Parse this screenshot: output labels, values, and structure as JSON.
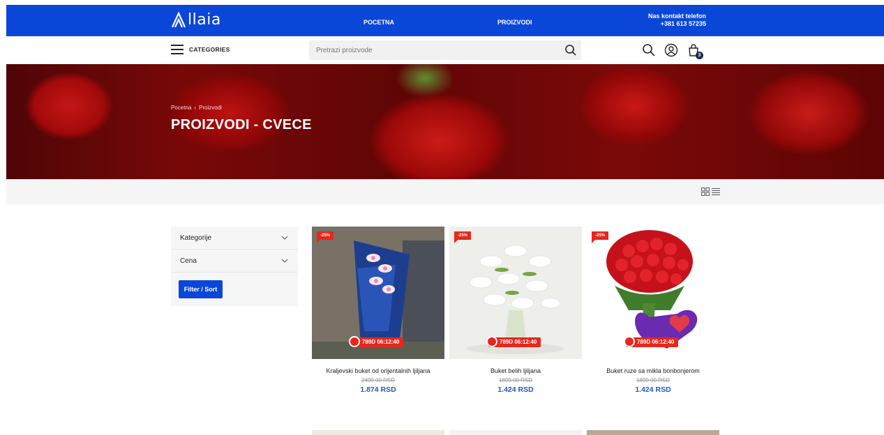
{
  "header": {
    "logo_text": "llaia",
    "nav": [
      "POCETNA",
      "PROIZVODI"
    ],
    "contact_label": "Nas kontakt telefon",
    "contact_phone": "+381 613 57235"
  },
  "subheader": {
    "categories_label": "CATEGORIES",
    "search_placeholder": "Pretrazi proizvode",
    "cart_count": "3"
  },
  "hero": {
    "breadcrumb": [
      "Pocetna",
      "›",
      "Proizvodi"
    ],
    "title": "PROIZVODI - CVECE"
  },
  "sidebar": {
    "filters": [
      "Kategorije",
      "Cena"
    ],
    "button_label": "Filter / Sort"
  },
  "products": [
    {
      "name": "Kraljevski buket od orijentalnih ljiljana",
      "old_price": "2499.00 RSD",
      "price": "1.874 RSD",
      "discount": "-25%",
      "timer": "789D 06:12:40"
    },
    {
      "name": "Buket belih ljiljana",
      "old_price": "1899.00 RSD",
      "price": "1.424 RSD",
      "discount": "-25%",
      "timer": "789D 06:12:40"
    },
    {
      "name": "Buket ruze sa mikla bonbonjerom",
      "old_price": "1899.00 RSD",
      "price": "1.424 RSD",
      "discount": "-25%",
      "timer": "789D 06:12:40"
    }
  ],
  "colors": {
    "brand": "#0a47d8",
    "sale": "#e8261d",
    "price": "#1f55c8"
  }
}
